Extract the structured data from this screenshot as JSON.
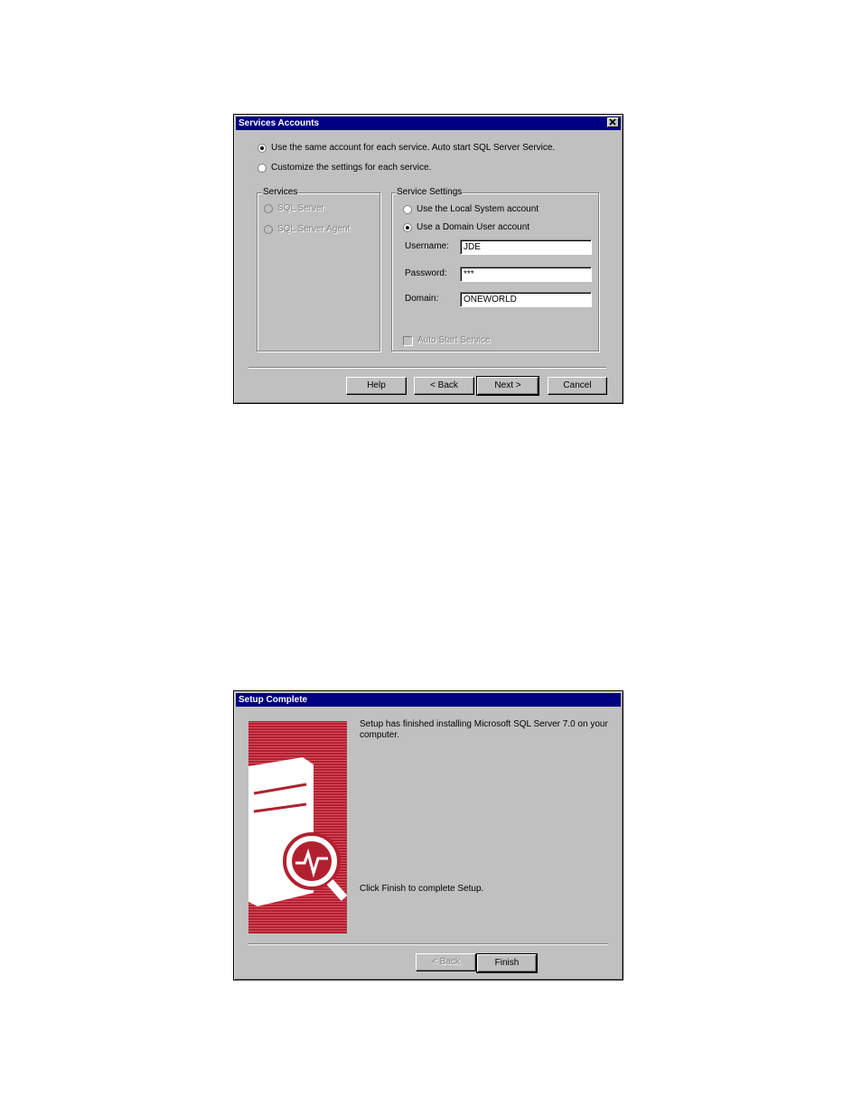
{
  "services_dialog": {
    "title": "Services Accounts",
    "option_same": "Use the same account for each service. Auto start SQL Server Service.",
    "option_customize": "Customize the settings for each service.",
    "services_group": {
      "legend": "Services",
      "items": [
        "SQL Server",
        "SQL Server Agent"
      ]
    },
    "settings_group": {
      "legend": "Service Settings",
      "local_system": "Use the Local System account",
      "domain_user": "Use a Domain User account",
      "username_label": "Username:",
      "username_value": "JDE",
      "password_label": "Password:",
      "password_value": "***",
      "domain_label": "Domain:",
      "domain_value": "ONEWORLD",
      "auto_start": "Auto Start Service"
    },
    "buttons": {
      "help": "Help",
      "back": "< Back",
      "next": "Next >",
      "cancel": "Cancel"
    }
  },
  "setup_dialog": {
    "title": "Setup Complete",
    "message": "Setup has finished installing Microsoft SQL Server 7.0 on your computer.",
    "finish_prompt": "Click Finish to complete Setup.",
    "buttons": {
      "back": "< Back",
      "finish": "Finish"
    },
    "banner_color": "#b22030"
  }
}
